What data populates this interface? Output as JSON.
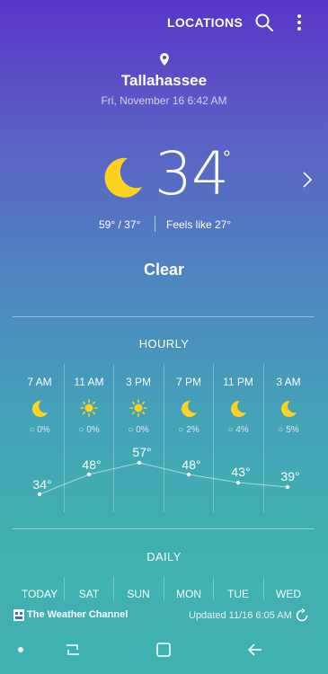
{
  "header": {
    "title": "LOCATIONS"
  },
  "location": {
    "city": "Tallahassee",
    "datetime": "Fri, November 16 6:42 AM"
  },
  "current": {
    "temp": "34",
    "degree": "°",
    "hilo": "59°  /  37°",
    "feels": "Feels like 27°",
    "condition": "Clear",
    "icon": "moon-icon"
  },
  "hourly": {
    "title": "HOURLY",
    "items": [
      {
        "time": "7 AM",
        "icon": "moon-icon",
        "precip": "0%",
        "temp": "34°"
      },
      {
        "time": "11 AM",
        "icon": "sun-icon",
        "precip": "0%",
        "temp": "48°"
      },
      {
        "time": "3 PM",
        "icon": "sun-icon",
        "precip": "0%",
        "temp": "57°"
      },
      {
        "time": "7 PM",
        "icon": "moon-icon",
        "precip": "2%",
        "temp": "48°"
      },
      {
        "time": "11 PM",
        "icon": "moon-icon",
        "precip": "4%",
        "temp": "43°"
      },
      {
        "time": "3 AM",
        "icon": "moon-icon",
        "precip": "5%",
        "temp": "39°"
      }
    ]
  },
  "daily": {
    "title": "DAILY",
    "days": [
      "TODAY",
      "SAT",
      "SUN",
      "MON",
      "TUE",
      "WED"
    ]
  },
  "footer": {
    "brand": "The Weather Channel",
    "updated": "Updated  11/16  6:05 AM"
  },
  "colors": {
    "sun": "#ffd21f",
    "moon": "#ffd21f"
  }
}
